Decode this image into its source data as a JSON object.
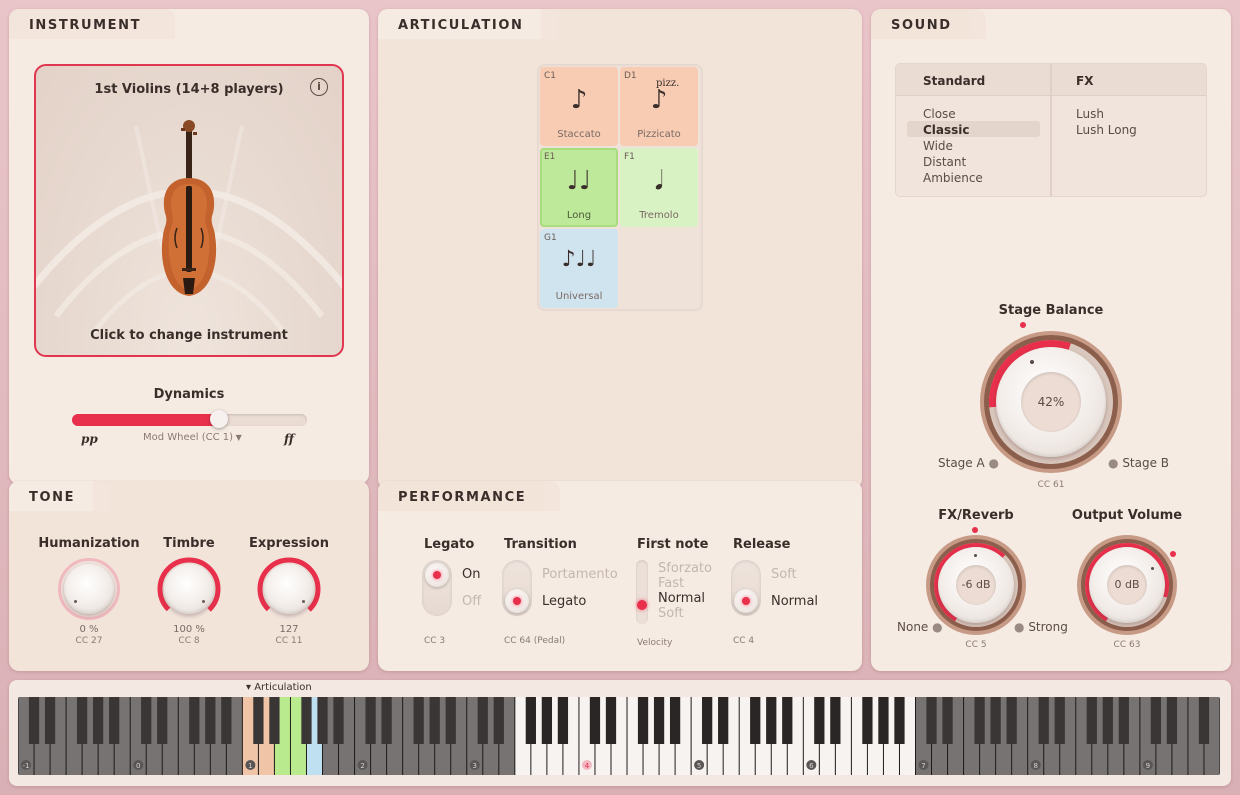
{
  "instrument": {
    "header": "INSTRUMENT",
    "name": "1st Violins (14+8 players)",
    "change_label": "Click to change instrument",
    "dynamics_label": "Dynamics",
    "dyn_min": "pp",
    "dyn_max": "ff",
    "dyn_source": "Mod Wheel (CC 1)",
    "dynamics_value": 0.66
  },
  "articulation": {
    "header": "ARTICULATION",
    "tiles": [
      {
        "code": "C1",
        "name": "Staccato",
        "glyph": "♪",
        "color": "#f7ccb3"
      },
      {
        "code": "D1",
        "name": "Pizzicato",
        "glyph": "♪",
        "extra": "pizz.",
        "color": "#f7ccb3"
      },
      {
        "code": "E1",
        "name": "Long",
        "glyph": "♩♩",
        "color": "#bfe99a"
      },
      {
        "code": "F1",
        "name": "Tremolo",
        "glyph": "𝅘𝅥",
        "color": "#d9f2c4"
      },
      {
        "code": "G1",
        "name": "Universal",
        "glyph": "♪♩♩",
        "color": "#cfe4ef"
      }
    ]
  },
  "sound": {
    "header": "SOUND",
    "col_standard": "Standard",
    "col_fx": "FX",
    "standard": [
      "Close",
      "Classic",
      "Wide",
      "Distant",
      "Ambience"
    ],
    "standard_selected": "Classic",
    "fx": [
      "Lush",
      "Lush Long"
    ],
    "stage_balance_label": "Stage Balance",
    "stage_balance_value": "42%",
    "stage_a": "Stage A",
    "stage_b": "Stage B",
    "stage_cc": "CC 61",
    "fx_reverb_label": "FX/Reverb",
    "fx_reverb_value": "-6 dB",
    "fx_none": "None",
    "fx_strong": "Strong",
    "fx_cc": "CC 5",
    "output_label": "Output Volume",
    "output_value": "0 dB",
    "output_cc": "CC 63"
  },
  "tone": {
    "header": "TONE",
    "knobs": [
      {
        "label": "Humanization",
        "value": "0 %",
        "cc": "CC 27"
      },
      {
        "label": "Timbre",
        "value": "100 %",
        "cc": "CC 8"
      },
      {
        "label": "Expression",
        "value": "127",
        "cc": "CC 11"
      }
    ]
  },
  "performance": {
    "header": "PERFORMANCE",
    "legato": {
      "label": "Legato",
      "on": "On",
      "off": "Off",
      "cc": "CC 3"
    },
    "transition": {
      "label": "Transition",
      "opt1": "Portamento",
      "opt2": "Legato",
      "cc": "CC 64 (Pedal)"
    },
    "first_note": {
      "label": "First note",
      "opts": [
        "Sforzato",
        "Fast",
        "Normal",
        "Soft"
      ],
      "source": "Velocity"
    },
    "release": {
      "label": "Release",
      "opt1": "Soft",
      "opt2": "Normal",
      "cc": "CC 4"
    }
  },
  "keyboard": {
    "articulation_label": "▾ Articulation",
    "octaves": [
      "-1",
      "0",
      "1",
      "2",
      "3",
      "4",
      "5",
      "6",
      "7",
      "8",
      "9"
    ]
  }
}
